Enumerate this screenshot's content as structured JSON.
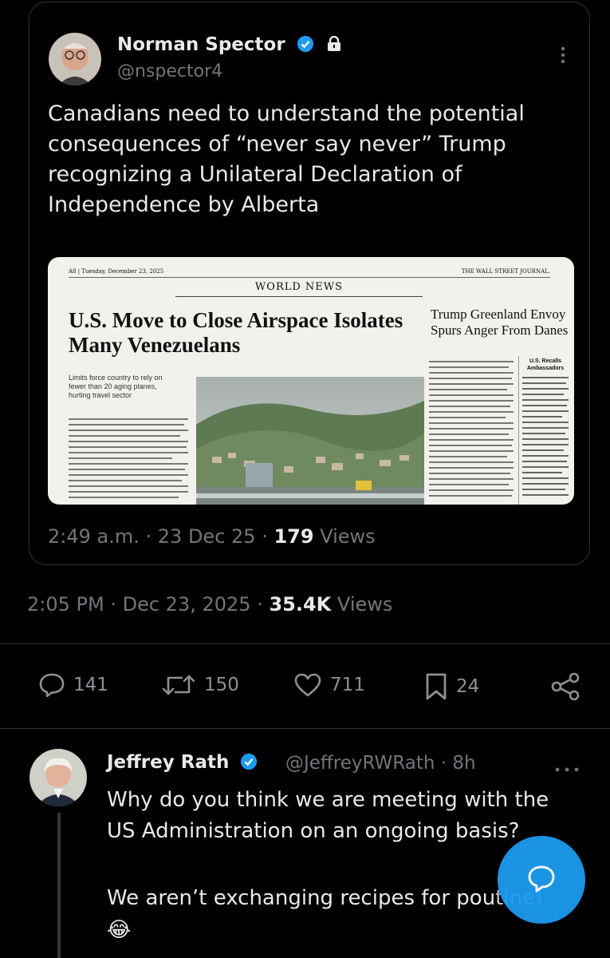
{
  "quoted_post": {
    "author_name": "Norman Spector",
    "author_handle": "@nspector4",
    "text": "Canadians need to understand the potential consequences of “never say never” Trump recognizing a Unilateral Declaration of Independence by Alberta",
    "time": "2:49 a.m.",
    "date": "23 Dec 25",
    "views_count": "179",
    "views_label": "Views",
    "newspaper": {
      "page_line": "A8 | Tuesday, December 23, 2025",
      "masthead": "THE WALL STREET JOURNAL.",
      "section": "WORLD NEWS",
      "headline": "U.S. Move to Close Airspace Isolates Many Venezuelans",
      "deck": "Limits force country to rely on fewer than 20 aging planes, hurting travel sector",
      "side_headline": "Trump Greenland Envoy Spurs Anger From Danes",
      "box_title": "U.S. Recalls Ambassadors"
    }
  },
  "main_post": {
    "time": "2:05 PM",
    "date": "Dec 23, 2025",
    "views_count": "35.4K",
    "views_label": "Views",
    "stats": {
      "replies": "141",
      "reposts": "150",
      "likes": "711",
      "bookmarks": "24"
    }
  },
  "reply": {
    "author_name": "Jeffrey Rath",
    "author_handle": "@JeffreyRWRath",
    "time_ago": "8h",
    "text_line1": "Why do you think we are meeting with the",
    "text_line2": "US Administration on an ongoing basis?",
    "text_line3": "We aren’t exchanging recipes for poutine!",
    "emoji": "😂"
  },
  "colors": {
    "accent": "#1d9bf0",
    "background": "#000000",
    "muted_text": "#71767b",
    "border": "#2f3336"
  }
}
